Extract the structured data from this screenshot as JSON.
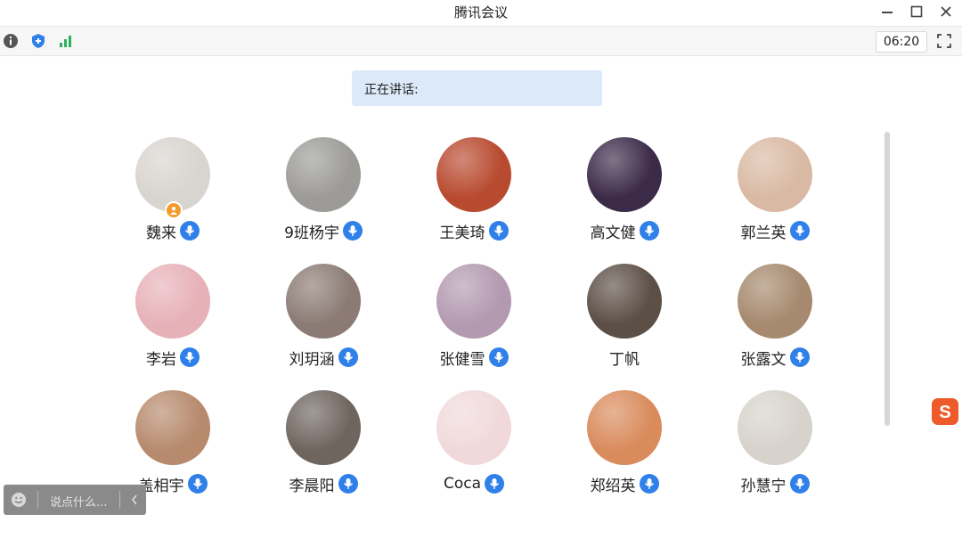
{
  "app": {
    "title": "腾讯会议"
  },
  "window_controls": {
    "minimize_icon": "minimize-icon",
    "maximize_icon": "maximize-icon",
    "close_icon": "close-icon"
  },
  "toolbar": {
    "info_icon": "info-icon",
    "security_icon": "shield-icon",
    "network_icon": "signal-bars-icon",
    "timer": "06:20",
    "fullscreen_icon": "fullscreen-icon"
  },
  "speaking": {
    "label": "正在讲话:"
  },
  "participants": [
    {
      "name": "魏来",
      "host": true,
      "mic": true,
      "avatar_color": "#d8d4cf"
    },
    {
      "name": "9班杨宇",
      "host": false,
      "mic": true,
      "avatar_color": "#9c9b98"
    },
    {
      "name": "王美琦",
      "host": false,
      "mic": true,
      "avatar_color": "#b84a2f"
    },
    {
      "name": "高文健",
      "host": false,
      "mic": true,
      "avatar_color": "#3b2a48"
    },
    {
      "name": "郭兰英",
      "host": false,
      "mic": true,
      "avatar_color": "#d9b9a3"
    },
    {
      "name": "李岩",
      "host": false,
      "mic": true,
      "avatar_color": "#e7b1b8"
    },
    {
      "name": "刘玥涵",
      "host": false,
      "mic": true,
      "avatar_color": "#8b7b74"
    },
    {
      "name": "张健雪",
      "host": false,
      "mic": true,
      "avatar_color": "#b39ab0"
    },
    {
      "name": "丁帆",
      "host": false,
      "mic": false,
      "avatar_color": "#5c4f46"
    },
    {
      "name": "张露文",
      "host": false,
      "mic": true,
      "avatar_color": "#a6896e"
    },
    {
      "name": "盖相宇",
      "host": false,
      "mic": true,
      "avatar_color": "#b78a6d"
    },
    {
      "name": "李晨阳",
      "host": false,
      "mic": true,
      "avatar_color": "#6f655f"
    },
    {
      "name": "Coca",
      "host": false,
      "mic": true,
      "avatar_color": "#f1d9db"
    },
    {
      "name": "郑绍英",
      "host": false,
      "mic": true,
      "avatar_color": "#d98b5c"
    },
    {
      "name": "孙慧宁",
      "host": false,
      "mic": true,
      "avatar_color": "#d7d2cb"
    }
  ],
  "chat": {
    "placeholder": "说点什么...",
    "emoji_icon": "emoji-icon",
    "collapse_icon": "chevron-left-icon"
  },
  "ime": {
    "label": "S"
  },
  "colors": {
    "mic_blue": "#2f80e8",
    "host_orange": "#f39a2b",
    "speaking_bg": "#dbe9f8"
  }
}
